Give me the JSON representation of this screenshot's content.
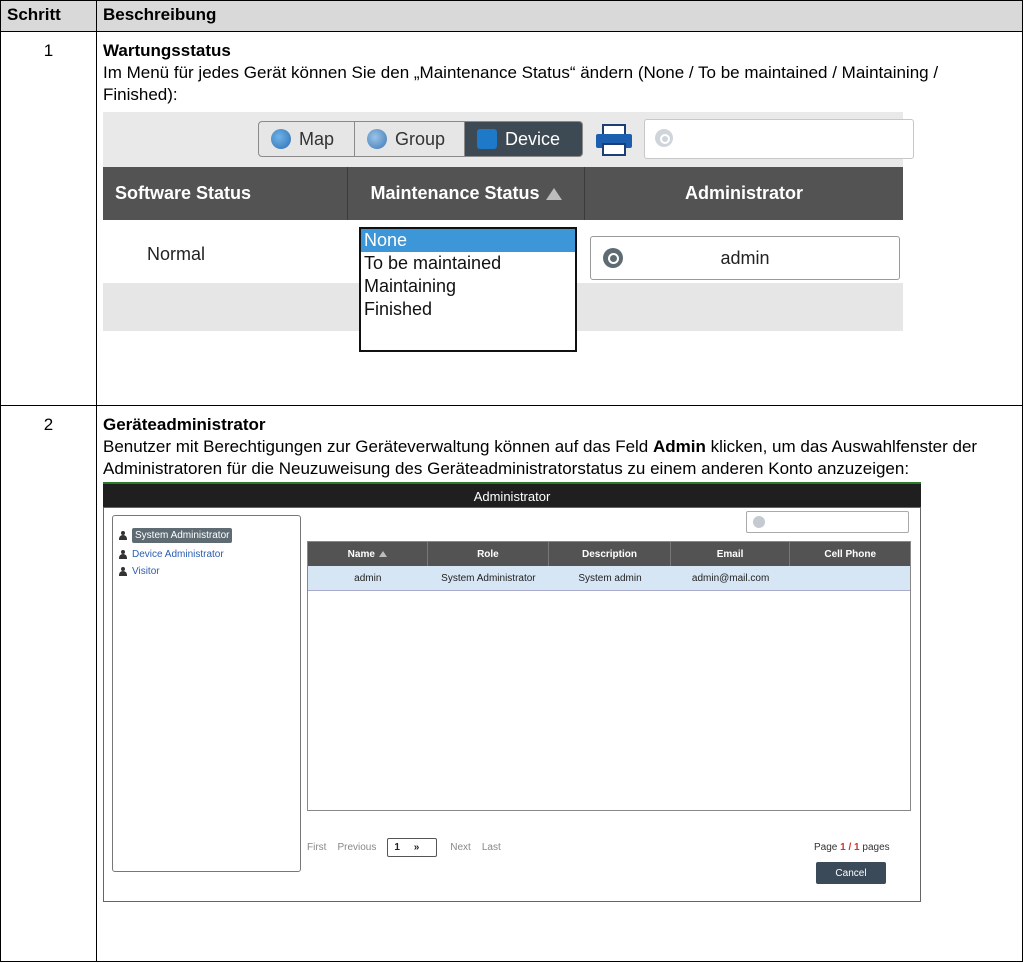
{
  "table": {
    "header_step": "Schritt",
    "header_desc": "Beschreibung"
  },
  "step1": {
    "number": "1",
    "title": "Wartungsstatus",
    "text": "Im Menü für jedes Gerät können Sie den „Maintenance Status“ ändern (None / To be maintained / Maintaining / Finished):",
    "shot": {
      "nav_map": "Map",
      "nav_group": "Group",
      "nav_device": "Device",
      "col_software": "Software Status",
      "col_maintenance": "Maintenance Status",
      "col_admin": "Administrator",
      "row_software": "Normal",
      "row_admin": "admin",
      "options": [
        "None",
        "To be maintained",
        "Maintaining",
        "Finished"
      ],
      "selected": "None"
    }
  },
  "step2": {
    "number": "2",
    "title": "Geräteadministrator",
    "text_before": "Benutzer mit Berechtigungen zur Geräteverwaltung können auf das Feld ",
    "text_bold": "Admin",
    "text_after": " klicken, um das Auswahlfenster der Administratoren für die Neuzuweisung des Geräteadministratorstatus zu einem anderen Konto anzuzeigen:",
    "shot": {
      "window_title": "Administrator",
      "roles": [
        "System Administrator",
        "Device Administrator",
        "Visitor"
      ],
      "columns": [
        "Name",
        "Role",
        "Description",
        "Email",
        "Cell Phone"
      ],
      "rows": [
        [
          "admin",
          "System Administrator",
          "System admin",
          "admin@mail.com",
          ""
        ]
      ],
      "pager": {
        "first": "First",
        "previous": "Previous",
        "page_select": "1",
        "next": "Next",
        "last": "Last"
      },
      "page_info_prefix": "Page ",
      "page_info_value": "1 / 1",
      "page_info_suffix": " pages",
      "cancel": "Cancel"
    }
  }
}
